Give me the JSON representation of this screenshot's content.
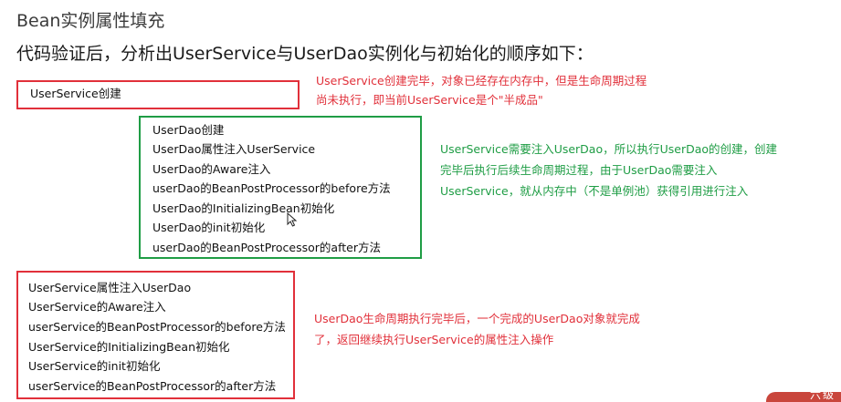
{
  "title": "Bean实例属性填充",
  "subtitle": "代码验证后，分析出UserService与UserDao实例化与初始化的顺序如下：",
  "box_create": {
    "label": "UserService创建"
  },
  "note_create": {
    "lines": [
      "UserService创建完毕，对象已经存在内存中，但是生命周期过程",
      "尚未执行，即当前UserService是个\"半成品\""
    ]
  },
  "box_userdao": {
    "lines": [
      "UserDao创建",
      "UserDao属性注入UserService",
      "UserDao的Aware注入",
      "userDao的BeanPostProcessor的before方法",
      "UserDao的InitializingBean初始化",
      "UserDao的init初始化",
      "userDao的BeanPostProcessor的after方法"
    ]
  },
  "note_userdao": {
    "lines": [
      "UserService需要注入UserDao，所以执行UserDao的创建，创建",
      "完毕后执行后续生命周期过程，由于UserDao需要注入",
      "UserService，就从内存中（不是单例池）获得引用进行注入"
    ]
  },
  "box_userservice": {
    "lines": [
      "UserService属性注入UserDao",
      "UserService的Aware注入",
      "userService的BeanPostProcessor的before方法",
      "UserService的InitializingBean初始化",
      "UserService的init初始化",
      "userService的BeanPostProcessor的after方法"
    ]
  },
  "note_userservice": {
    "lines": [
      "UserDao生命周期执行完毕后，一个完成的UserDao对象就完成",
      "了，返回继续执行UserService的属性注入操作"
    ]
  },
  "corner_badge": {
    "text": "六级"
  },
  "colors": {
    "red": "#e1303a",
    "green": "#1f9d45",
    "text": "#111111"
  },
  "icons": {
    "cursor": "mouse-pointer-icon"
  }
}
